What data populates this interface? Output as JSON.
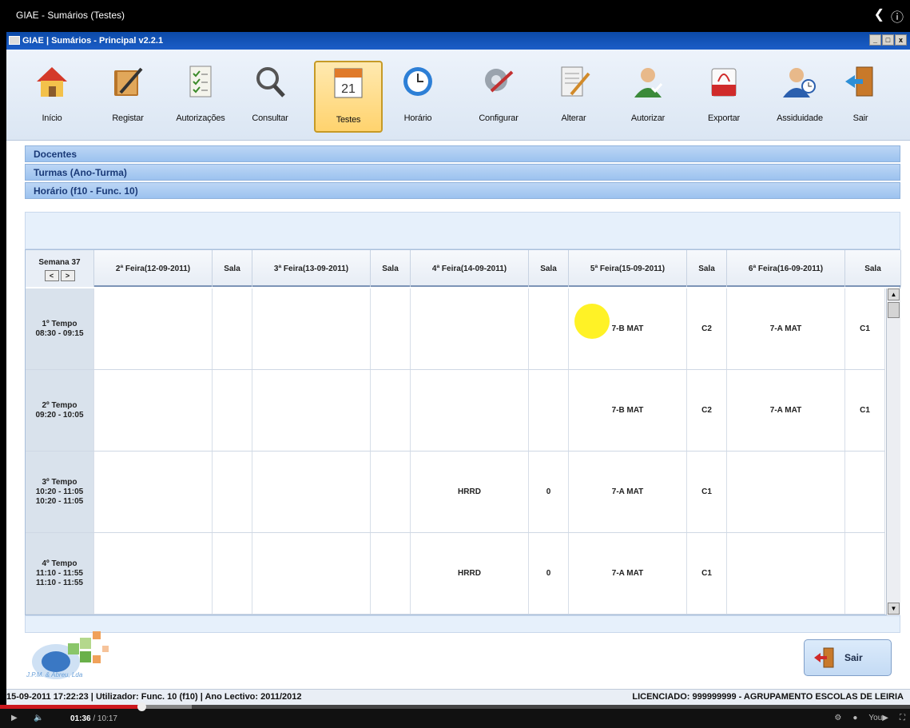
{
  "player": {
    "video_title": "GIAE - Sumários (Testes)",
    "current_time": "01:36",
    "duration": "/ 10:17",
    "progress_fraction": 0.156,
    "top_icons": [
      "share-icon",
      "info-icon"
    ],
    "bottom_icons": [
      "settings-icon",
      "quality-icon",
      "youtube-logo",
      "fullscreen-icon"
    ]
  },
  "window": {
    "title": "GIAE | Sumários - Principal v2.2.1",
    "buttons": [
      "_",
      "□",
      "x"
    ]
  },
  "toolbar": {
    "items": [
      {
        "label": "Início",
        "icon": "home-icon"
      },
      {
        "label": "Registar",
        "icon": "book-pencil-icon"
      },
      {
        "label": "Autorizações",
        "icon": "checklist-icon"
      },
      {
        "label": "Consultar",
        "icon": "magnifier-icon"
      },
      {
        "label": "Testes",
        "icon": "calendar-icon",
        "calendar_day": "21",
        "active": true
      },
      {
        "label": "Horário",
        "icon": "clock-icon"
      },
      {
        "label": "Configurar",
        "icon": "gear-tools-icon"
      },
      {
        "label": "Alterar",
        "icon": "notepad-pencil-icon"
      },
      {
        "label": "Autorizar",
        "icon": "user-check-icon"
      },
      {
        "label": "Exportar",
        "icon": "pdf-export-icon"
      },
      {
        "label": "Assiduidade",
        "icon": "user-clock-icon"
      },
      {
        "label": "Sair",
        "icon": "exit-door-icon"
      }
    ]
  },
  "sections": [
    {
      "label": "Docentes"
    },
    {
      "label": "Turmas (Ano-Turma)"
    },
    {
      "label": "Horário (f10 - Func. 10)"
    }
  ],
  "schedule": {
    "week_label": "Semana 37",
    "prev": "<",
    "next": ">",
    "columns": [
      "2ª Feira(12-09-2011)",
      "Sala",
      "3ª Feira(13-09-2011)",
      "Sala",
      "4ª Feira(14-09-2011)",
      "Sala",
      "5ª Feira(15-09-2011)",
      "Sala",
      "6ª Feira(16-09-2011)",
      "Sala"
    ],
    "rows": [
      {
        "time_lines": [
          "1º Tempo",
          "08:30 - 09:15"
        ],
        "cells": [
          "",
          "",
          "",
          "",
          "",
          "",
          "7-B MAT",
          "C2",
          "7-A MAT",
          "C1"
        ]
      },
      {
        "time_lines": [
          "2º Tempo",
          "09:20 - 10:05"
        ],
        "cells": [
          "",
          "",
          "",
          "",
          "",
          "",
          "7-B MAT",
          "C2",
          "7-A MAT",
          "C1"
        ]
      },
      {
        "time_lines": [
          "3º Tempo",
          "10:20 - 11:05",
          "10:20 - 11:05"
        ],
        "cells": [
          "",
          "",
          "",
          "",
          "HRRD",
          "0",
          "7-A MAT",
          "C1",
          "",
          ""
        ]
      },
      {
        "time_lines": [
          "4º Tempo",
          "11:10 - 11:55",
          "11:10 - 11:55"
        ],
        "cells": [
          "",
          "",
          "",
          "",
          "HRRD",
          "0",
          "7-A MAT",
          "C1",
          "",
          ""
        ]
      }
    ]
  },
  "logo_text": "J.P.M. & Abreu, Lda",
  "exit_button": {
    "label": "Sair"
  },
  "status": {
    "left": "15-09-2011 17:22:23  | Utilizador: Func. 10 (f10) | Ano Lectivo: 2011/2012",
    "right": "LICENCIADO: 999999999 - AGRUPAMENTO ESCOLAS DE LEIRIA"
  }
}
